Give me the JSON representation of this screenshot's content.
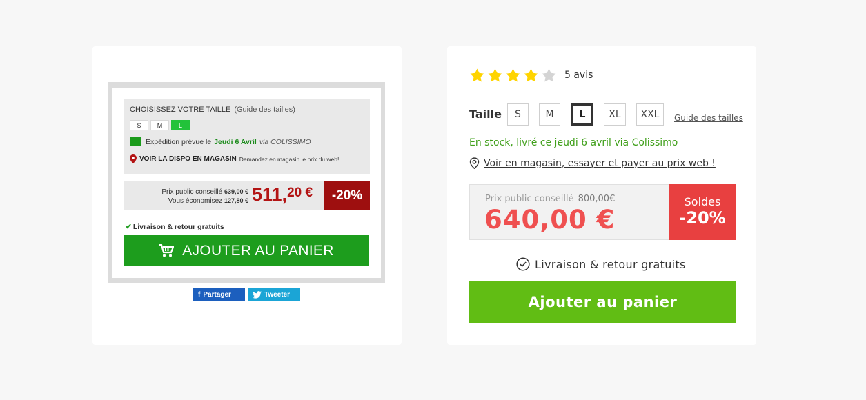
{
  "old_design": {
    "choose_title": "CHOISISSEZ VOTRE TAILLE",
    "guide_label": "(Guide des tailles)",
    "sizes": [
      "S",
      "M",
      "L"
    ],
    "selected_size": "L",
    "shipping_prefix": "Expédition prévue le",
    "shipping_day": "Jeudi 6 Avril",
    "shipping_via": "via COLISSIMO",
    "store_label": "VOIR LA DISPO EN MAGASIN",
    "store_small": "Demandez en magasin le prix du web!",
    "public_price_label": "Prix public conseillé",
    "public_price_value": "639,00 €",
    "savings_label": "Vous économisez",
    "savings_value": "127,80 €",
    "price_int": "511,",
    "price_cents": "20 €",
    "discount": "-20%",
    "free_shipping": "Livraison & retour gratuits",
    "add_to_cart": "AJOUTER AU PANIER",
    "share_facebook": "Partager",
    "share_twitter": "Tweeter"
  },
  "new_design": {
    "rating": 4,
    "max_rating": 5,
    "reviews_link": "5 avis",
    "size_label": "Taille",
    "sizes": [
      "S",
      "M",
      "L",
      "XL",
      "XXL"
    ],
    "selected_size": "L",
    "size_guide": "Guide des tailles",
    "stock_text": "En stock, livré ce jeudi 6 avril via Colissimo",
    "store_link": "Voir en magasin, essayer et payer au prix web !",
    "public_price_label": "Prix public conseillé",
    "old_price": "800,00€",
    "price": "640,00 €",
    "sale_label": "Soldes",
    "discount": "-20%",
    "free_shipping": "Livraison & retour gratuits",
    "add_to_cart": "Ajouter au panier"
  },
  "colors": {
    "background": "#f7f7f7",
    "star_filled": "#ffd400",
    "star_empty": "#d4d4d4",
    "stock_green": "#41a01c",
    "price_red": "#ef5050",
    "sale_red": "#e84040",
    "cart_green": "#61bd14",
    "old_cart_green": "#1d9d1d",
    "old_price_red": "#b31414"
  }
}
